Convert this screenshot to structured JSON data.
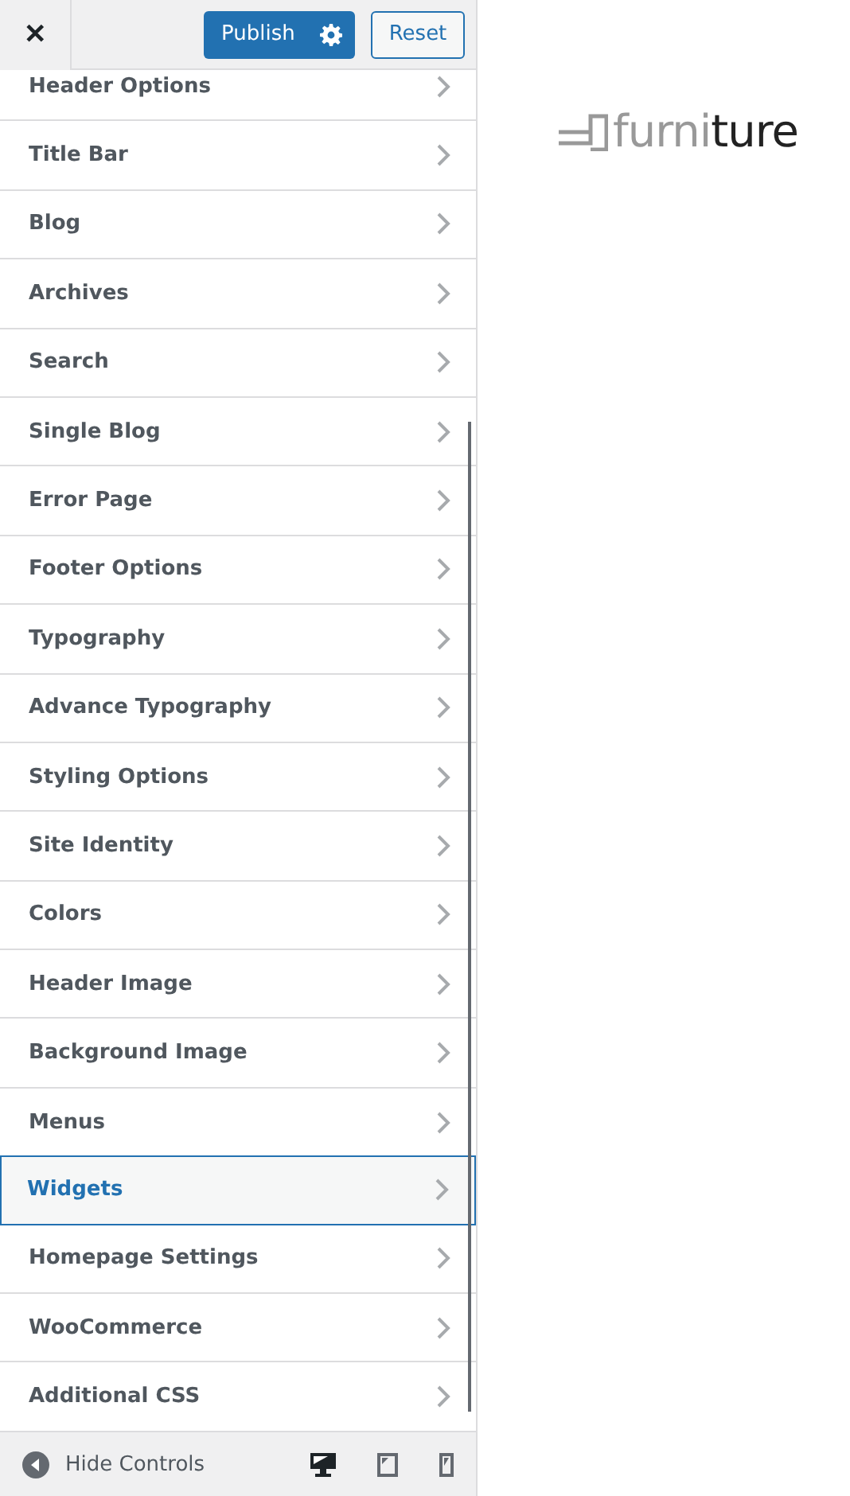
{
  "header": {
    "close": "✕",
    "publish": "Publish",
    "reset": "Reset"
  },
  "menu": [
    {
      "label": "Header Options",
      "selected": false
    },
    {
      "label": "Title Bar",
      "selected": false
    },
    {
      "label": "Blog",
      "selected": false
    },
    {
      "label": "Archives",
      "selected": false
    },
    {
      "label": "Search",
      "selected": false
    },
    {
      "label": "Single Blog",
      "selected": false
    },
    {
      "label": "Error Page",
      "selected": false
    },
    {
      "label": "Footer Options",
      "selected": false
    },
    {
      "label": "Typography",
      "selected": false
    },
    {
      "label": "Advance Typography",
      "selected": false
    },
    {
      "label": "Styling Options",
      "selected": false
    },
    {
      "label": "Site Identity",
      "selected": false
    },
    {
      "label": "Colors",
      "selected": false
    },
    {
      "label": "Header Image",
      "selected": false
    },
    {
      "label": "Background Image",
      "selected": false
    },
    {
      "label": "Menus",
      "selected": false
    },
    {
      "label": "Widgets",
      "selected": true
    },
    {
      "label": "Homepage Settings",
      "selected": false
    },
    {
      "label": "WooCommerce",
      "selected": false
    },
    {
      "label": "Additional CSS",
      "selected": false
    }
  ],
  "footer": {
    "hide_controls": "Hide Controls",
    "devices": [
      {
        "kind": "desktop",
        "selected": true
      },
      {
        "kind": "tablet",
        "selected": false
      },
      {
        "kind": "mobile",
        "selected": false
      }
    ]
  },
  "logo": {
    "parts": [
      {
        "text": "furni",
        "kind": "light"
      },
      {
        "text": "ture",
        "kind": "dark"
      }
    ]
  }
}
